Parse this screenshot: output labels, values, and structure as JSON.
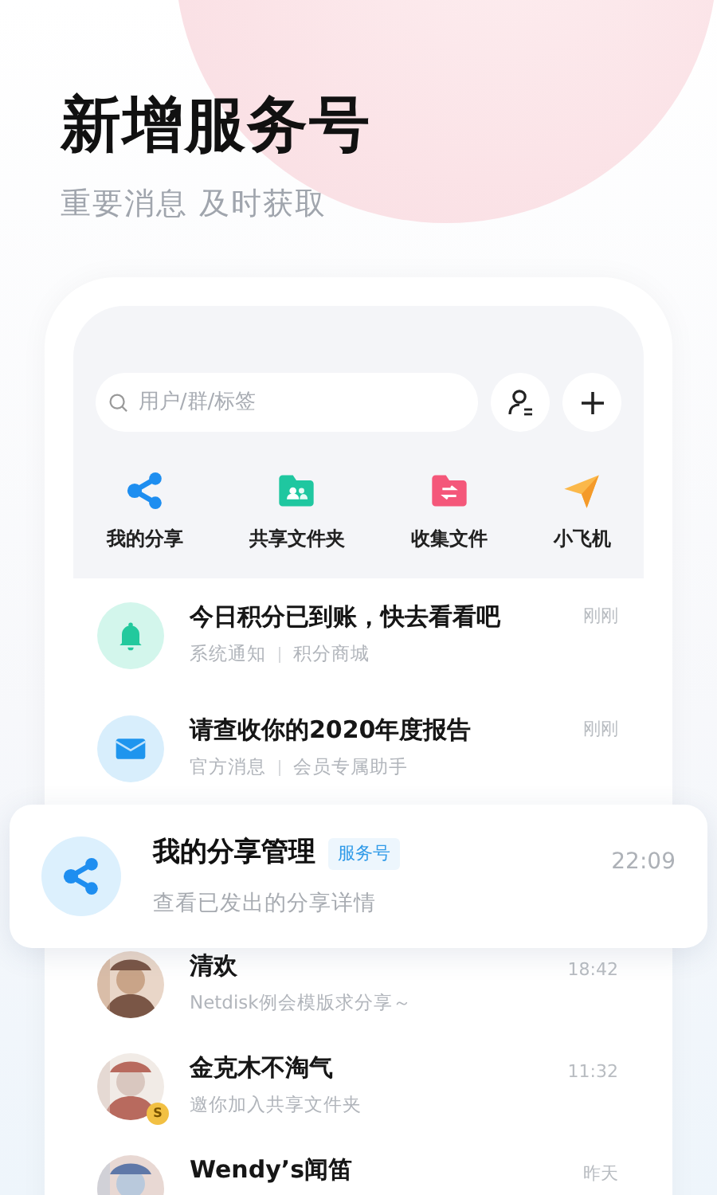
{
  "headline": "新增服务号",
  "subheadline": "重要消息 及时获取",
  "search": {
    "placeholder": "用户/群/标签"
  },
  "shortcuts": [
    {
      "label": "我的分享",
      "kind": "share"
    },
    {
      "label": "共享文件夹",
      "kind": "shared-folder"
    },
    {
      "label": "收集文件",
      "kind": "collect-folder"
    },
    {
      "label": "小飞机",
      "kind": "plane"
    }
  ],
  "messages": [
    {
      "kind": "bell",
      "title": "今日积分已到账，快去看看吧",
      "category": "系统通知",
      "source": "积分商城",
      "time": "刚刚"
    },
    {
      "kind": "mail",
      "title": "请查收你的2020年度报告",
      "category": "官方消息",
      "source": "会员专属助手",
      "time": "刚刚"
    }
  ],
  "featured": {
    "kind": "share",
    "title": "我的分享管理",
    "tag": "服务号",
    "subtitle": "查看已发出的分享详情",
    "time": "22:09"
  },
  "chats": [
    {
      "name": "清欢",
      "preview": "Netdisk例会模版求分享～",
      "time": "18:42",
      "kind": "picture"
    },
    {
      "name": "金克木不淘气",
      "preview": "邀你加入共享文件夹",
      "time": "11:32",
      "badge": "S",
      "kind": "picture"
    },
    {
      "name": "Wendy’s闻笛",
      "time": "昨天",
      "kind": "picture"
    }
  ]
}
